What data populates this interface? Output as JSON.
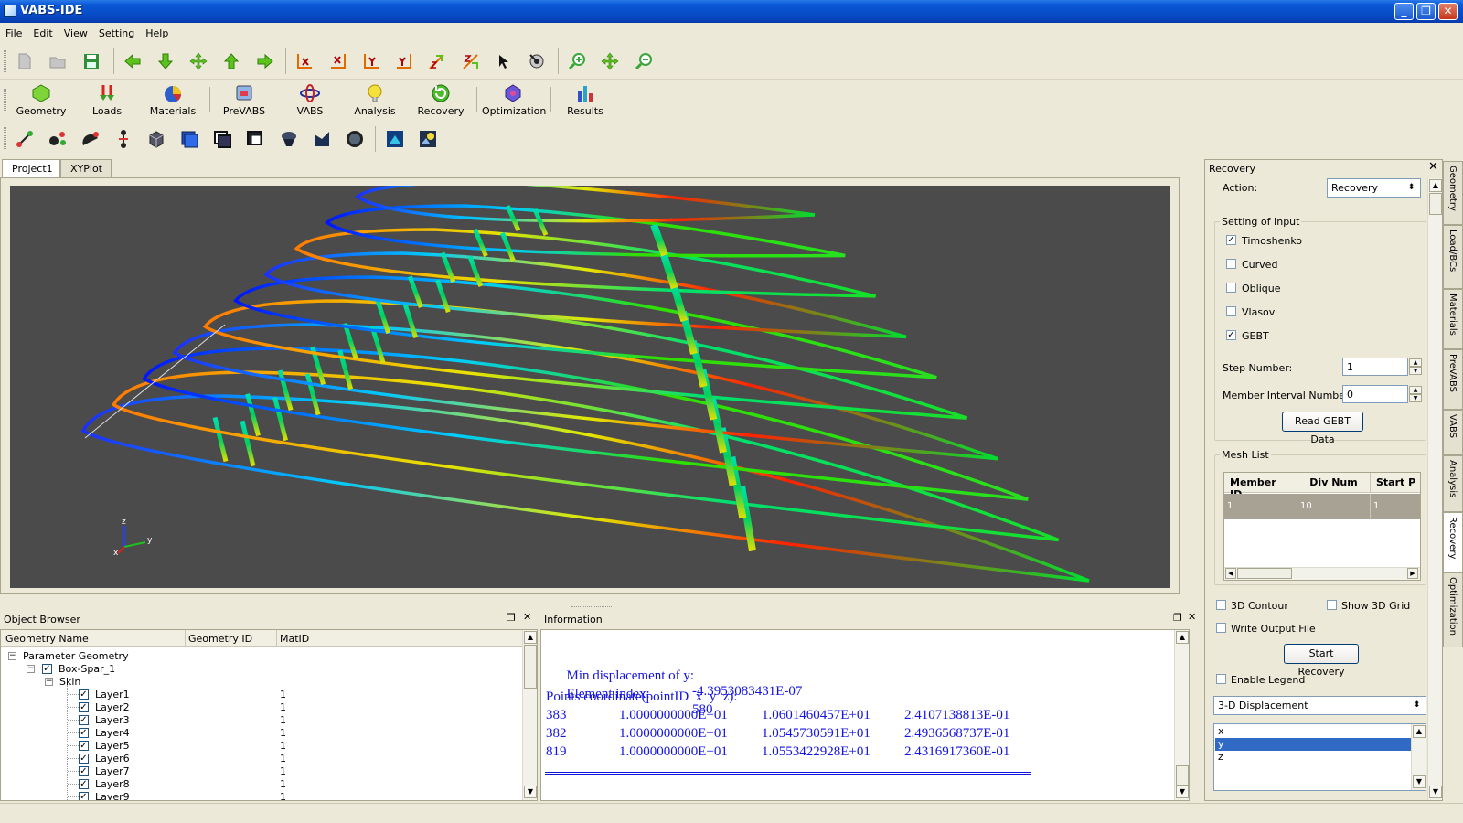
{
  "window": {
    "title": "VABS-IDE",
    "min": "_",
    "max": "❐",
    "close": "✕"
  },
  "menu": [
    "File",
    "Edit",
    "View",
    "Setting",
    "Help"
  ],
  "main_toolbar": [
    {
      "label": "Geometry",
      "icon": "geometry-icon"
    },
    {
      "label": "Loads",
      "icon": "loads-icon"
    },
    {
      "label": "Materials",
      "icon": "materials-icon"
    },
    {
      "label": "PreVABS",
      "icon": "prevabs-icon"
    },
    {
      "label": "VABS",
      "icon": "vabs-icon"
    },
    {
      "label": "Analysis",
      "icon": "analysis-icon"
    },
    {
      "label": "Recovery",
      "icon": "recovery-icon"
    },
    {
      "label": "Optimization",
      "icon": "optimization-icon"
    },
    {
      "label": "Results",
      "icon": "results-icon"
    }
  ],
  "tabs": [
    "Project1",
    "XYPlot"
  ],
  "viewport": {
    "background": "#4b4b4b",
    "axis_labels": [
      "z",
      "y",
      "x"
    ]
  },
  "object_browser": {
    "title": "Object Browser",
    "columns": [
      "Geometry Name",
      "Geometry ID",
      "MatID"
    ],
    "root": "Parameter Geometry",
    "spar": "Box-Spar_1",
    "skin": "Skin",
    "layers": [
      {
        "name": "Layer1",
        "mat": "1"
      },
      {
        "name": "Layer2",
        "mat": "1"
      },
      {
        "name": "Layer3",
        "mat": "1"
      },
      {
        "name": "Layer4",
        "mat": "1"
      },
      {
        "name": "Layer5",
        "mat": "1"
      },
      {
        "name": "Layer6",
        "mat": "1"
      },
      {
        "name": "Layer7",
        "mat": "1"
      },
      {
        "name": "Layer8",
        "mat": "1"
      },
      {
        "name": "Layer9",
        "mat": "1"
      }
    ]
  },
  "information": {
    "title": "Information",
    "min_disp_label": "Min displacement of y:",
    "min_disp_value": "-4.3953083431E-07",
    "element_label": "Element index:",
    "element_value": "580",
    "points_label": "Points coordinate(pointID  x  y  z):",
    "rows": [
      [
        "383",
        "1.0000000000E+01",
        "1.0601460457E+01",
        "2.4107138813E-01"
      ],
      [
        "382",
        "1.0000000000E+01",
        "1.0545730591E+01",
        "2.4936568737E-01"
      ],
      [
        "819",
        "1.0000000000E+01",
        "1.0553422928E+01",
        "2.4316917360E-01"
      ]
    ]
  },
  "recovery_panel": {
    "title": "Recovery",
    "action_label": "Action:",
    "action_value": "Recovery",
    "setting_title": "Setting of Input",
    "checks": [
      {
        "label": "Timoshenko",
        "checked": true
      },
      {
        "label": "Curved",
        "checked": false
      },
      {
        "label": "Oblique",
        "checked": false
      },
      {
        "label": "Vlasov",
        "checked": false
      },
      {
        "label": "GEBT",
        "checked": true
      }
    ],
    "step_label": "Step Number:",
    "step_value": "1",
    "member_label": "Member Interval Number:",
    "member_value": "0",
    "read_btn": "Read GEBT Data",
    "mesh_title": "Mesh List",
    "mesh_cols": [
      "Member ID",
      "Div Num",
      "Start P"
    ],
    "mesh_row": [
      "1",
      "10",
      "1"
    ],
    "contour_label": "3D Contour",
    "grid_label": "Show 3D Grid",
    "write_label": "Write Output File",
    "start_btn": "Start Recovery",
    "legend_label": "Enable Legend",
    "display_value": "3-D Displacement",
    "components": [
      "x",
      "y",
      "z"
    ],
    "selected_component": "y"
  },
  "side_tabs": [
    "Geometry",
    "Load/BCs",
    "Materials",
    "PreVABS",
    "VABS",
    "Analysis",
    "Recovery",
    "Optimization"
  ]
}
